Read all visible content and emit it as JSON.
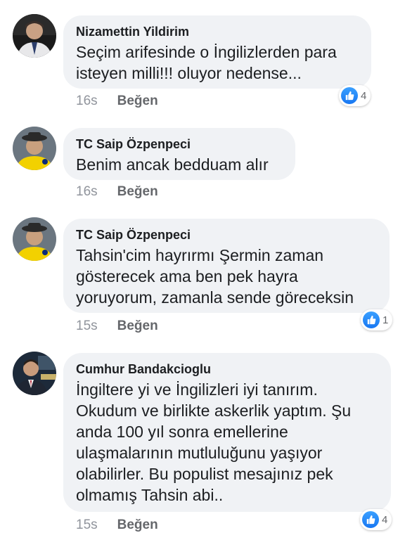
{
  "comments": [
    {
      "author": "Nizamettin Yildirim",
      "text": "Seçim arifesinde o İngilizlerden para\nisteyen milli!!! oluyor nedense...",
      "time": "16s",
      "like_label": "Beğen",
      "reaction_count": "4"
    },
    {
      "author": "TC Saip Özpenpeci",
      "text": "Benim ancak bedduam alır",
      "time": "16s",
      "like_label": "Beğen"
    },
    {
      "author": "TC Saip Özpenpeci",
      "text": "Tahsin'cim hayrırmı Şermin zaman\ngösterecek ama ben pek hayra\nyoruyorum, zamanla sende göreceksin",
      "time": "15s",
      "like_label": "Beğen",
      "reaction_count": "1"
    },
    {
      "author": "Cumhur Bandakcioglu",
      "text": "İngiltere yi ve İngilizleri iyi tanırım.\nOkudum ve birlikte askerlik yaptım.  Şu\nanda 100 yıl sonra emellerine\nulaşmalarının mutluluğunu yaşıyor\nolabilirler. Bu populist  mesajınız pek\nolmamış Tahsin abi..",
      "time": "15s",
      "like_label": "Beğen",
      "reaction_count": "4"
    }
  ],
  "colors": {
    "bubble": "#f0f2f5",
    "like_blue": "#1877f2",
    "meta_gray": "#65676b"
  }
}
